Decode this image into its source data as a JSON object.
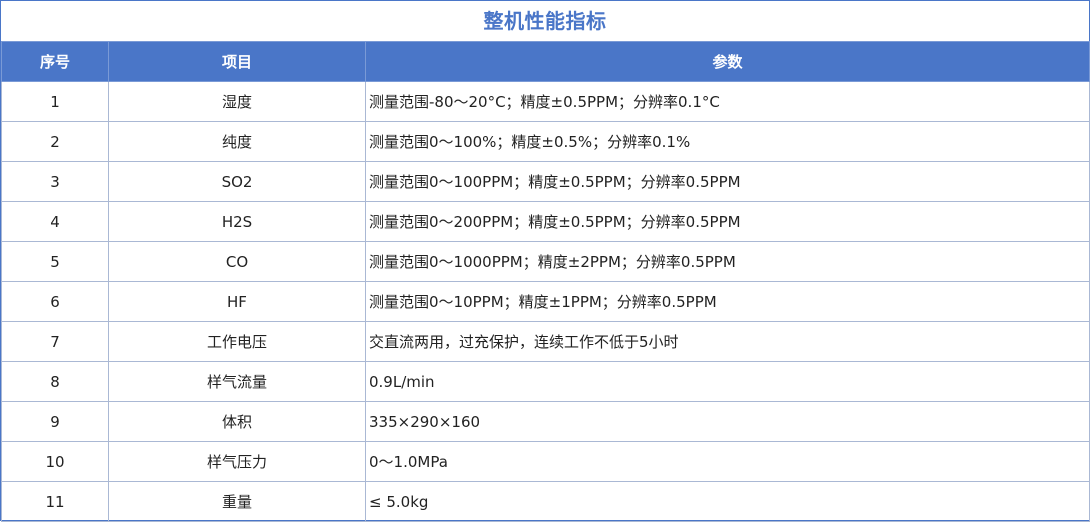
{
  "title": "整机性能指标",
  "headers": [
    "序号",
    "项目",
    "参数"
  ],
  "rows": [
    {
      "no": "1",
      "item": "湿度",
      "param": "测量范围-80～20°C；精度±0.5PPM；分辨率0.1°C"
    },
    {
      "no": "2",
      "item": "纯度",
      "param": "测量范围0～100%；精度±0.5%；分辨率0.1%"
    },
    {
      "no": "3",
      "item": "SO2",
      "param": "测量范围0～100PPM；精度±0.5PPM；分辨率0.5PPM"
    },
    {
      "no": "4",
      "item": "H2S",
      "param": "测量范围0～200PPM；精度±0.5PPM；分辨率0.5PPM"
    },
    {
      "no": "5",
      "item": "CO",
      "param": "测量范围0～1000PPM；精度±2PPM；分辨率0.5PPM"
    },
    {
      "no": "6",
      "item": "HF",
      "param": "测量范围0～10PPM；精度±1PPM；分辨率0.5PPM"
    },
    {
      "no": "7",
      "item": "工作电压",
      "param": "交直流两用，过充保护，连续工作不低于5小时"
    },
    {
      "no": "8",
      "item": "样气流量",
      "param": "0.9L/min"
    },
    {
      "no": "9",
      "item": "体积",
      "param": "335×290×160"
    },
    {
      "no": "10",
      "item": "样气压力",
      "param": "0～1.0MPa"
    },
    {
      "no": "11",
      "item": "重量",
      "param": "≤ 5.0kg"
    }
  ],
  "colors": {
    "accent": "#4a76c8",
    "grid": "#aab8d4"
  }
}
